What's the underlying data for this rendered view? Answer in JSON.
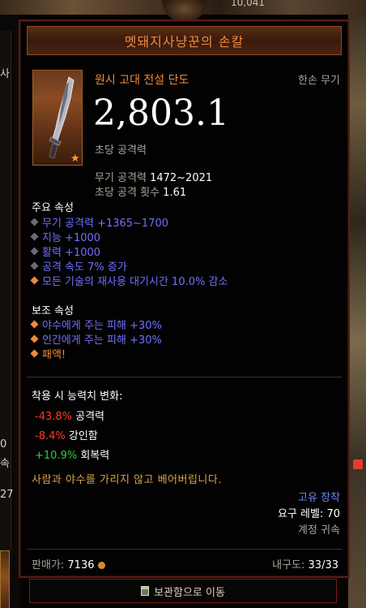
{
  "background": {
    "top_number": "10,041",
    "left_fragments": [
      "사",
      "0",
      "속",
      "27"
    ]
  },
  "item": {
    "name": "멧돼지사냥꾼의 손칼",
    "quality_type": "원시 고대 전설 단도",
    "slot": "한손 무기",
    "dps": "2,803.1",
    "dps_label": "초당 공격력",
    "weapon_damage_label": "무기 공격력",
    "weapon_damage_value": "1472~2021",
    "attack_speed_label": "초당 공격 횟수",
    "attack_speed_value": "1.61"
  },
  "primary": {
    "heading": "주요 속성",
    "affixes": [
      {
        "text": "무기 공격력 +1365~1700",
        "bullet": "gray"
      },
      {
        "text": "지능 +1000",
        "bullet": "gray"
      },
      {
        "text": "활력 +1000",
        "bullet": "gray"
      },
      {
        "text": "공격 속도 7% 증가",
        "bullet": "gray"
      },
      {
        "text": "모든 기술의 재사용 대기시간 10.0% 감소",
        "bullet": "orange"
      }
    ]
  },
  "secondary": {
    "heading": "보조 속성",
    "affixes": [
      {
        "text": "야수에게 주는 피해 +30%",
        "bullet": "orange",
        "color": "blue"
      },
      {
        "text": "인간에게 주는 피해 +30%",
        "bullet": "orange",
        "color": "blue"
      },
      {
        "text": "패액!",
        "bullet": "orange",
        "color": "orange"
      }
    ]
  },
  "changes": {
    "heading": "착용 시 능력치 변화:",
    "rows": [
      {
        "value": "-43.8%",
        "label": "공격력",
        "sign": "neg"
      },
      {
        "value": "-8.4%",
        "label": "강인함",
        "sign": "neg"
      },
      {
        "value": "+10.9%",
        "label": "회복력",
        "sign": "pos"
      }
    ]
  },
  "flavor": "사람과 야수를 가리지 않고 베어버립니다.",
  "meta": {
    "unique": "고유 장착",
    "required_level_label": "요구 레벨:",
    "required_level": "70",
    "account_bound": "계정 귀속"
  },
  "footer": {
    "price_label": "판매가:",
    "price": "7136",
    "durability_label": "내구도:",
    "durability": "33/33"
  },
  "move_button": {
    "label": "보관함으로 이동"
  },
  "colors": {
    "legendary": "#f08a3a",
    "magic": "#7070ff",
    "negative": "#ff3a2a",
    "positive": "#28d040",
    "flavor": "#d8a44a",
    "unique": "#6a8aff"
  }
}
